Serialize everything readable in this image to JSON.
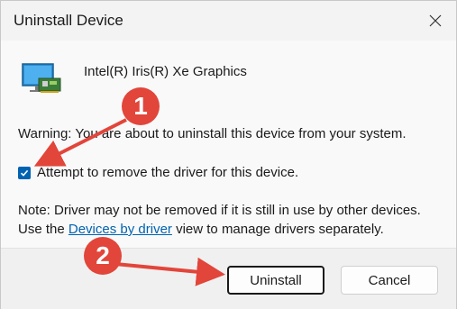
{
  "dialog": {
    "title": "Uninstall Device",
    "device_name": "Intel(R) Iris(R) Xe Graphics",
    "warning": "Warning: You are about to uninstall this device from your system.",
    "checkbox_label": "Attempt to remove the driver for this device.",
    "checkbox_checked": true,
    "note_prefix": "Note: Driver may not be removed if it is still in use by other devices. Use the ",
    "note_link": "Devices by driver",
    "note_suffix": " view to manage drivers separately."
  },
  "buttons": {
    "uninstall": "Uninstall",
    "cancel": "Cancel"
  },
  "annotations": {
    "step1": "1",
    "step2": "2",
    "color": "#e2453a"
  },
  "colors": {
    "accent": "#0063b1"
  },
  "icons": {
    "device": "monitor-with-card-icon",
    "close": "close-icon",
    "checkmark": "checkmark-icon"
  }
}
